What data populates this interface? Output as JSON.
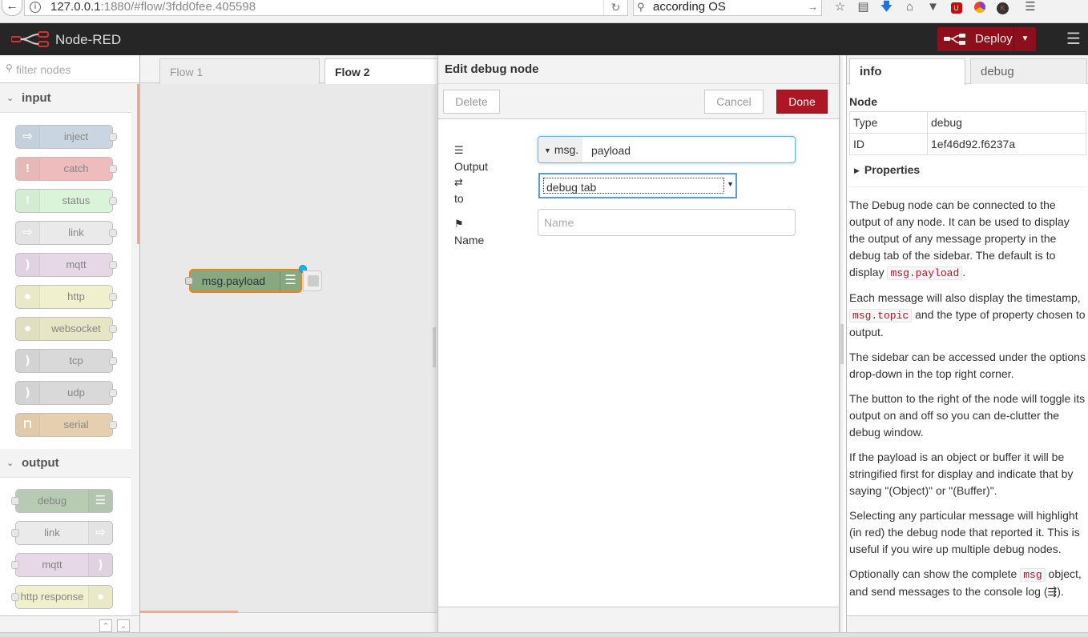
{
  "browser": {
    "url_host": "127.0.0.1",
    "url_rest": ":1880/#flow/3fdd0fee.405598",
    "search_text": "according OS"
  },
  "header": {
    "app_title": "Node-RED",
    "deploy_label": "Deploy"
  },
  "palette": {
    "filter_placeholder": "filter nodes",
    "categories": [
      {
        "label": "input",
        "nodes": [
          "inject",
          "catch",
          "status",
          "link",
          "mqtt",
          "http",
          "websocket",
          "tcp",
          "udp",
          "serial"
        ]
      },
      {
        "label": "output",
        "nodes": [
          "debug",
          "link",
          "mqtt",
          "http response"
        ]
      }
    ],
    "colors": {
      "inject": "#a6bbcf",
      "catch": "#e49191",
      "status": "#c0edc0",
      "link": "#dddddd",
      "mqtt": "#d8bfd8",
      "http": "#e7e7ae",
      "websocket": "#d7d7a0",
      "tcp": "#c0c0c0",
      "udp": "#c0c0c0",
      "serial": "#d7b07a",
      "debug": "#87a980",
      "http response": "#e7e7ae"
    }
  },
  "workspace": {
    "tabs": [
      "Flow 1",
      "Flow 2"
    ],
    "active_tab": "Flow 2",
    "node_label": "msg.payload"
  },
  "tray": {
    "title": "Edit debug node",
    "delete_label": "Delete",
    "cancel_label": "Cancel",
    "done_label": "Done",
    "output_label": "Output",
    "output_type": "msg.",
    "output_value": "payload",
    "to_label": "to",
    "to_value": "debug tab",
    "name_label": "Name",
    "name_placeholder": "Name"
  },
  "sidebar": {
    "tabs": [
      "info",
      "debug"
    ],
    "section_title": "Node",
    "type_key": "Type",
    "type_value": "debug",
    "id_key": "ID",
    "id_value": "1ef46d92.f6237a",
    "properties_label": "Properties",
    "help": {
      "p1_a": "The Debug node can be connected to the output of any node. It can be used to display the output of any message property in the debug tab of the sidebar. The default is to display ",
      "p1_code": "msg.payload",
      "p1_b": ".",
      "p2_a": "Each message will also display the timestamp, ",
      "p2_code": "msg.topic",
      "p2_b": " and the type of property chosen to output.",
      "p3": "The sidebar can be accessed under the options drop-down in the top right corner.",
      "p4": "The button to the right of the node will toggle its output on and off so you can de-clutter the debug window.",
      "p5": "If the payload is an object or buffer it will be stringified first for display and indicate that by saying \"(Object)\" or \"(Buffer)\".",
      "p6": "Selecting any particular message will highlight (in red) the debug node that reported it. This is useful if you wire up multiple debug nodes.",
      "p7_a": "Optionally can show the complete ",
      "p7_code": "msg",
      "p7_b": " object, and send messages to the console log (⇶)."
    }
  }
}
